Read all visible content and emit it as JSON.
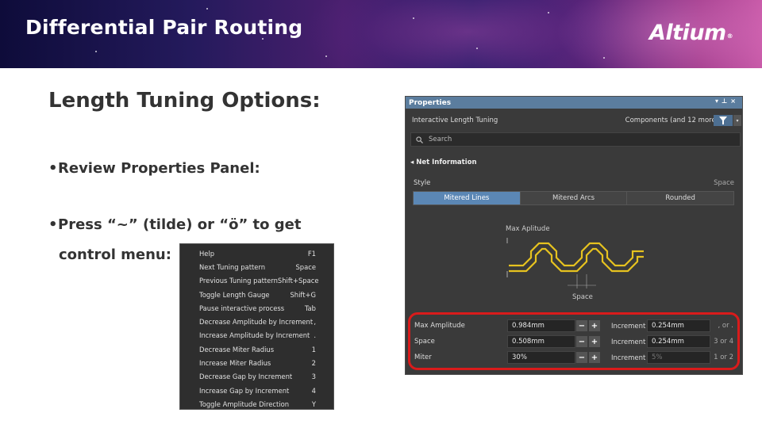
{
  "banner": {
    "title": "Differential Pair Routing",
    "logo": "Altium"
  },
  "slide": {
    "title": "Length Tuning Options:",
    "bullets": [
      "Review Properties Panel:",
      "Press “~” (tilde) or “ö” to get",
      "control menu:"
    ]
  },
  "menu": {
    "items": [
      {
        "label": "Help",
        "key": "F1"
      },
      {
        "label": "Next Tuning pattern",
        "key": "Space"
      },
      {
        "label": "Previous Tuning pattern",
        "key": "Shift+Space"
      },
      {
        "label": "Toggle Length Gauge",
        "key": "Shift+G"
      },
      {
        "label": "Pause interactive process",
        "key": "Tab"
      },
      {
        "label": "Decrease Amplitude by Increment",
        "key": ","
      },
      {
        "label": "Increase Amplitude by Increment",
        "key": "."
      },
      {
        "label": "Decrease Miter Radius",
        "key": "1"
      },
      {
        "label": "Increase Miter Radius",
        "key": "2"
      },
      {
        "label": "Decrease Gap by Increment",
        "key": "3"
      },
      {
        "label": "Increase Gap by Increment",
        "key": "4"
      },
      {
        "label": "Toggle Amplitude Direction",
        "key": "Y"
      }
    ]
  },
  "panel": {
    "title": "Properties",
    "mode": "Interactive Length Tuning",
    "filter_text": "Components (and 12 more)",
    "search_placeholder": "Search",
    "section": "Net Information",
    "style_label": "Style",
    "space_label": "Space",
    "segments": [
      "Mitered Lines",
      "Mitered Arcs",
      "Rounded"
    ],
    "active_segment": "Mitered Lines",
    "diagram": {
      "max_label": "Max Aplitude",
      "space_label": "Space"
    },
    "params": [
      {
        "name": "Max Amplitude",
        "value": "0.984mm",
        "inc_label": "Increment",
        "inc_value": "0.254mm",
        "hint": ", or ."
      },
      {
        "name": "Space",
        "value": "0.508mm",
        "inc_label": "Increment",
        "inc_value": "0.254mm",
        "hint": "3 or 4"
      },
      {
        "name": "Miter",
        "value": "30%",
        "inc_label": "Increment",
        "inc_value": "5%",
        "hint": "1 or 2"
      }
    ]
  },
  "colors": {
    "accent": "#5b87b5",
    "highlight": "#d91b1b",
    "trace": "#e6c21f"
  }
}
